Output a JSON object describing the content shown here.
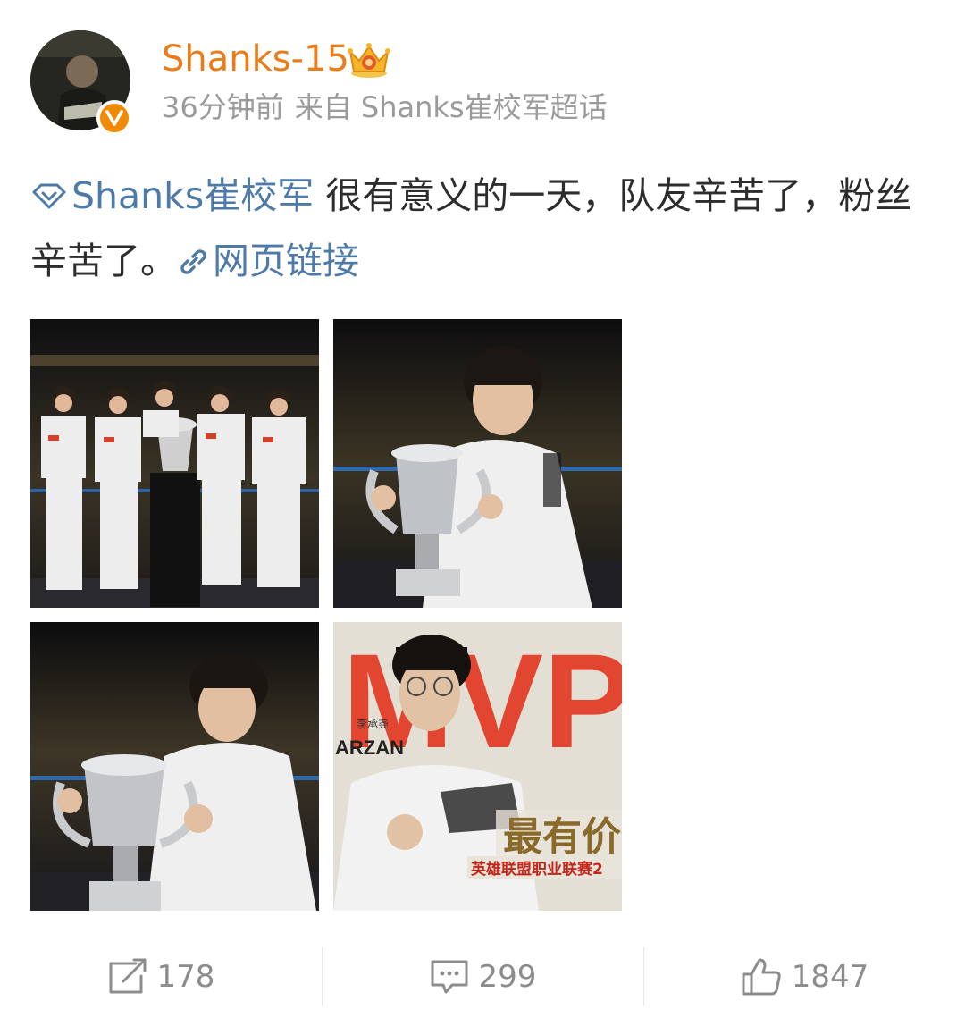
{
  "post": {
    "author": {
      "name": "Shanks-15",
      "verified_icon": "verified-v-icon",
      "badge_icon": "crown-badge-icon",
      "avatar_caption": "avatar",
      "name_color": "#ea7d1a"
    },
    "meta": {
      "time": "36分钟前",
      "source": "来自 Shanks崔校军超话"
    },
    "content": {
      "topic_icon": "diamond-supertopic-icon",
      "topic": "Shanks崔校军",
      "text": " 很有意义的一天，队友辛苦了，粉丝辛苦了。",
      "link_icon": "link-icon",
      "link_label": "网页链接",
      "link_color": "#4e7aa8"
    },
    "photos": [
      {
        "alt": "team-with-trophy"
      },
      {
        "alt": "player-with-trophy"
      },
      {
        "alt": "player-holding-trophy"
      },
      {
        "alt": "mvp-poster",
        "overlay_title": "MVP",
        "player_name": "ARZAN",
        "player_cn": "李承尧",
        "subtitle": "最有价值",
        "caption": "英雄联盟职业联赛2"
      }
    ],
    "actions": [
      {
        "icon": "repost-icon",
        "count": "178"
      },
      {
        "icon": "comment-icon",
        "count": "299"
      },
      {
        "icon": "like-icon",
        "count": "1847"
      }
    ]
  }
}
